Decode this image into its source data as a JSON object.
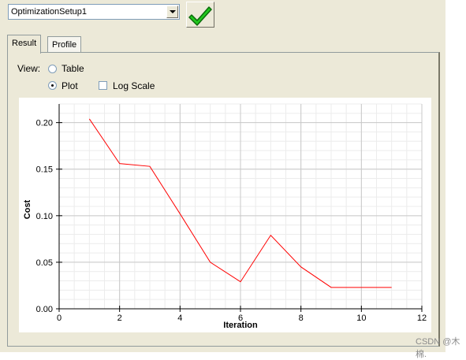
{
  "setup": {
    "selected": "OptimizationSetup1"
  },
  "tabs": [
    {
      "label": "Result"
    },
    {
      "label": "Profile"
    }
  ],
  "view": {
    "label": "View:",
    "table_label": "Table",
    "plot_label": "Plot",
    "log_scale_label": "Log Scale",
    "selected": "Plot",
    "log_scale": false
  },
  "chart_data": {
    "type": "line",
    "xlabel": "Iteration",
    "ylabel": "Cost",
    "x": [
      1,
      2,
      3,
      4,
      5,
      6,
      7,
      8,
      9,
      10,
      11
    ],
    "series": [
      {
        "values": [
          0.204,
          0.156,
          0.153,
          0.102,
          0.05,
          0.029,
          0.079,
          0.045,
          0.023,
          0.023,
          0.023
        ],
        "color": "#ff0000"
      }
    ],
    "xlim": [
      0,
      12
    ],
    "ylim": [
      0,
      0.22
    ],
    "xticks": [
      "0",
      "2",
      "4",
      "6",
      "8",
      "10",
      "12"
    ],
    "yticks": [
      "0.00",
      "0.05",
      "0.10",
      "0.15",
      "0.20"
    ],
    "grid": true
  },
  "watermark": "CSDN @木棉."
}
